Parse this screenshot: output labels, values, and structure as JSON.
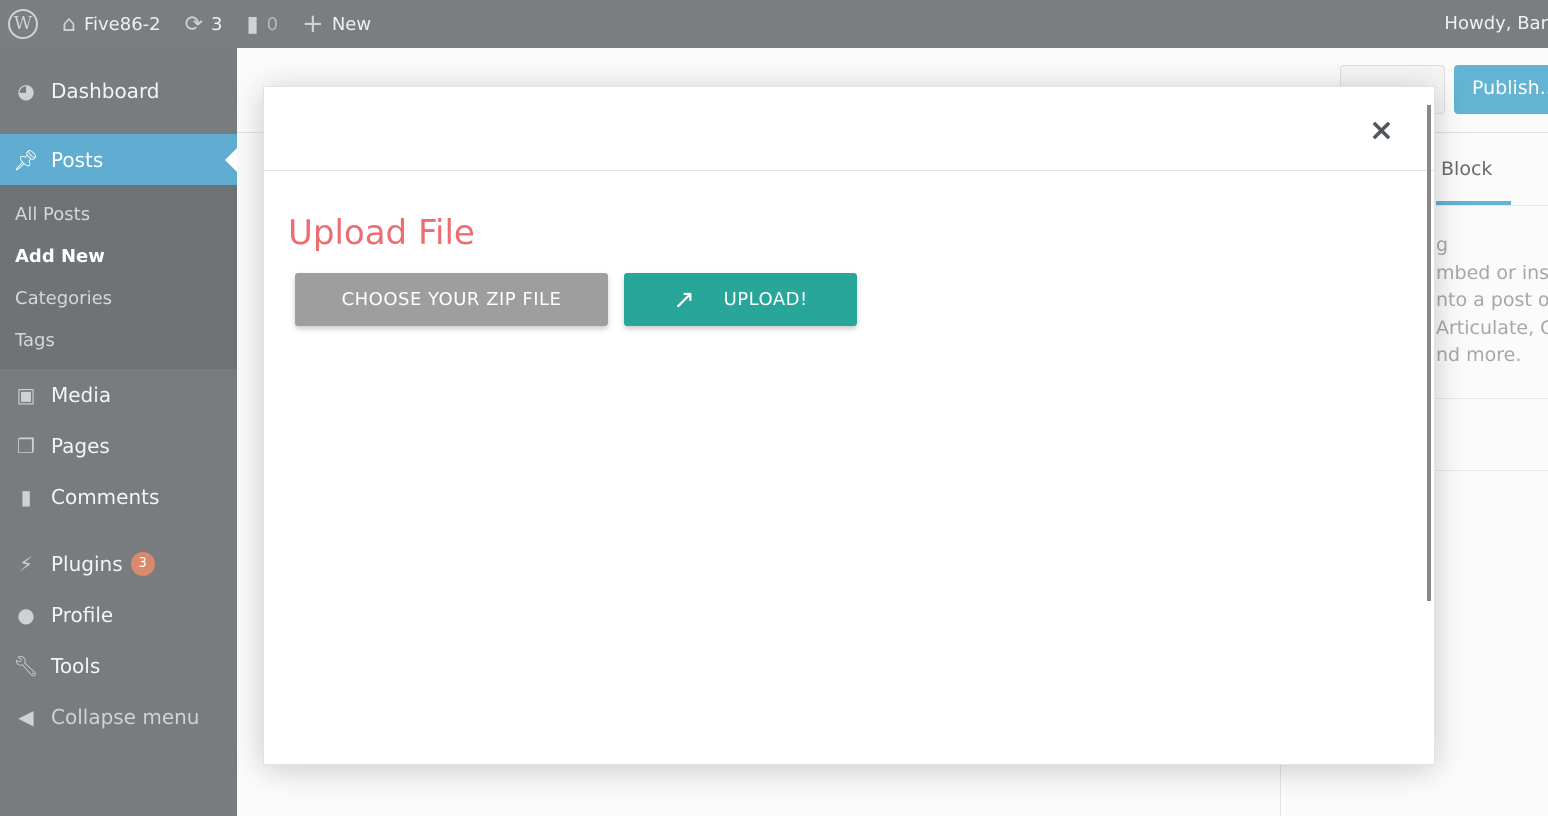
{
  "adminbar": {
    "site": "Five86-2",
    "updates": "3",
    "comments": "0",
    "new": "New",
    "howdy": "Howdy, Bar"
  },
  "sidebar": {
    "items": [
      {
        "label": "Dashboard",
        "icon": "dashboard-icon"
      },
      {
        "label": "Posts",
        "icon": "pin-icon",
        "active": true
      },
      {
        "label": "Media",
        "icon": "media-icon"
      },
      {
        "label": "Pages",
        "icon": "pages-icon"
      },
      {
        "label": "Comments",
        "icon": "comment-icon"
      },
      {
        "label": "Plugins",
        "icon": "plugin-icon",
        "badge": "3"
      },
      {
        "label": "Profile",
        "icon": "user-icon"
      },
      {
        "label": "Tools",
        "icon": "wrench-icon"
      },
      {
        "label": "Collapse menu",
        "icon": "collapse-icon"
      }
    ],
    "posts_sub": [
      "All Posts",
      "Add New",
      "Categories",
      "Tags"
    ]
  },
  "editor": {
    "publish": "Publish...",
    "block_tab": "Block",
    "sidebar_fragments": [
      "g",
      "mbed or inse",
      "nto a post or",
      "Articulate, Ca",
      "nd more."
    ]
  },
  "modal": {
    "title": "Upload File",
    "choose": "CHOOSE YOUR ZIP FILE",
    "upload": "UPLOAD!",
    "close": "×"
  },
  "colors": {
    "title": "#ee6c72",
    "upload": "#27a699",
    "choose": "#9e9e9e",
    "accent": "#5fadd1",
    "badge": "#d88a6c"
  }
}
